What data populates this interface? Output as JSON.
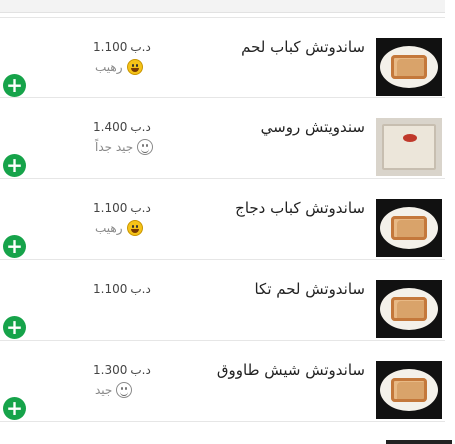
{
  "currency": "د.ب",
  "add_symbol": "+",
  "items": [
    {
      "name": "ساندوتش كباب لحم",
      "price": "1.100",
      "rating": "رهيب",
      "rating_icon": "grinning-face-icon",
      "image": "kebab-sandwich-photo"
    },
    {
      "name": "سندويتش روسي",
      "price": "1.400",
      "rating": "جيد جداً",
      "rating_icon": "smile-outline-icon",
      "image": "wrapped-sandwich-photo"
    },
    {
      "name": "ساندوتش كباب دجاج",
      "price": "1.100",
      "rating": "رهيب",
      "rating_icon": "grinning-face-icon",
      "image": "chicken-kebab-sandwich-photo"
    },
    {
      "name": "ساندوتش لحم تكا",
      "price": "1.100",
      "rating": "",
      "rating_icon": "",
      "image": "tikka-sandwich-photo"
    },
    {
      "name": "ساندوتش شيش طاووق",
      "price": "1.300",
      "rating": "جيد",
      "rating_icon": "neutral-smile-outline-icon",
      "image": "shish-tawook-sandwich-photo"
    }
  ]
}
